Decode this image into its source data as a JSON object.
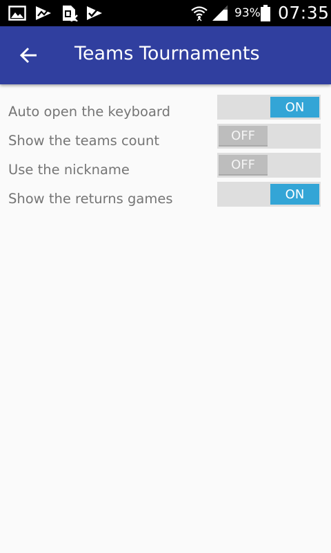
{
  "status_bar": {
    "notification_icons": [
      "image-icon",
      "trending-icon",
      "sim-error-icon",
      "check-flag-icon"
    ],
    "system_icons": [
      "wifi-icon",
      "signal-icon",
      "battery-icon"
    ],
    "battery_percent": "93%",
    "clock": "07:35"
  },
  "app_bar": {
    "title": "Teams Tournaments",
    "back_icon": "arrow-back-icon",
    "color": "#303f9f"
  },
  "settings": [
    {
      "label": "Auto open the keyboard",
      "state": "ON"
    },
    {
      "label": "Show the teams count",
      "state": "OFF"
    },
    {
      "label": "Use the nickname",
      "state": "OFF"
    },
    {
      "label": "Show the returns games",
      "state": "ON"
    }
  ],
  "colors": {
    "toggle_on": "#33a5d6",
    "toggle_off": "#bdbdbd",
    "toggle_track": "#dedede",
    "label_text": "#757575"
  }
}
